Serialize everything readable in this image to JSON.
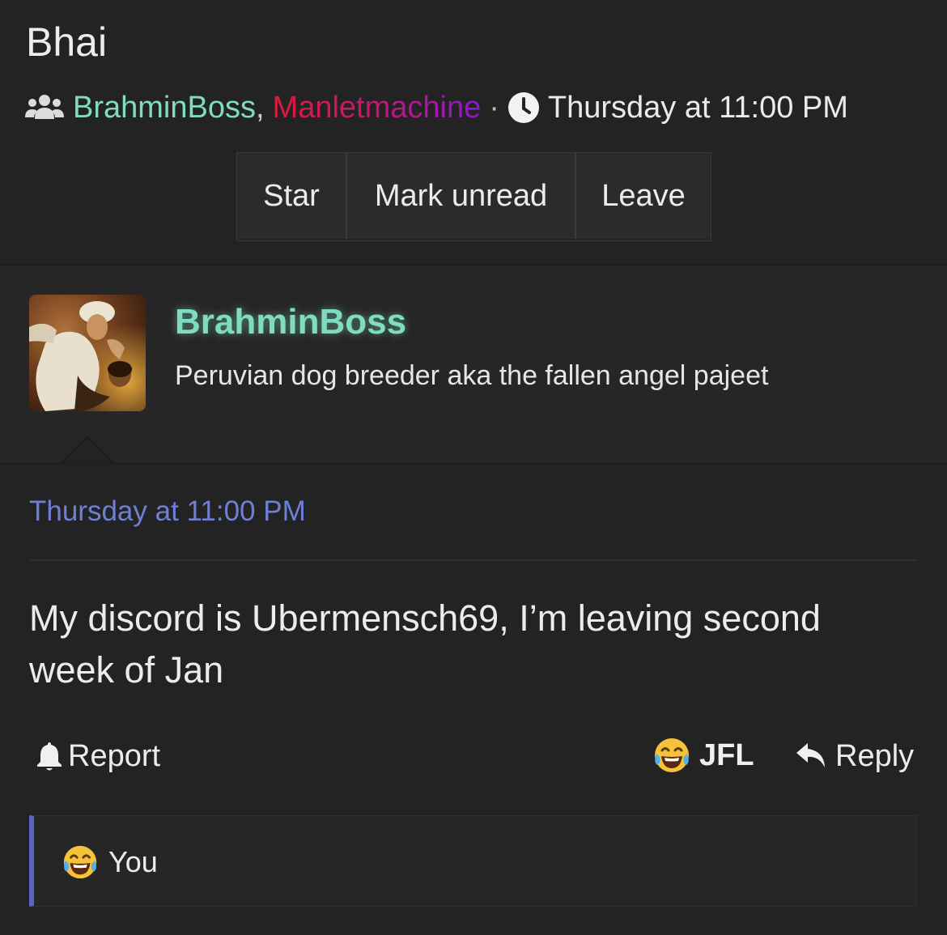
{
  "conversation": {
    "title": "Bhai",
    "participants": [
      {
        "name": "BrahminBoss",
        "color": "#7fdcc0"
      },
      {
        "name": "Manletmachine",
        "color": "#e0193a"
      }
    ],
    "separator": ",",
    "dot": "·",
    "date": "Thursday at 11:00 PM",
    "icons": {
      "participants": "users-icon",
      "time": "clock-icon"
    }
  },
  "actions": {
    "star": "Star",
    "mark_unread": "Mark unread",
    "leave": "Leave"
  },
  "message": {
    "author": "BrahminBoss",
    "author_color": "#7fdcc0",
    "user_title": "Peruvian dog breeder aka the fallen angel pajeet",
    "date": "Thursday at 11:00 PM",
    "body": "My discord is Ubermensch69, I’m leaving second week of Jan",
    "footer": {
      "report": "Report",
      "reaction": "JFL",
      "reply": "Reply"
    },
    "reactions": {
      "emoji": "laughing-tears-emoji",
      "who": "You",
      "accent": "#5865c7"
    }
  }
}
